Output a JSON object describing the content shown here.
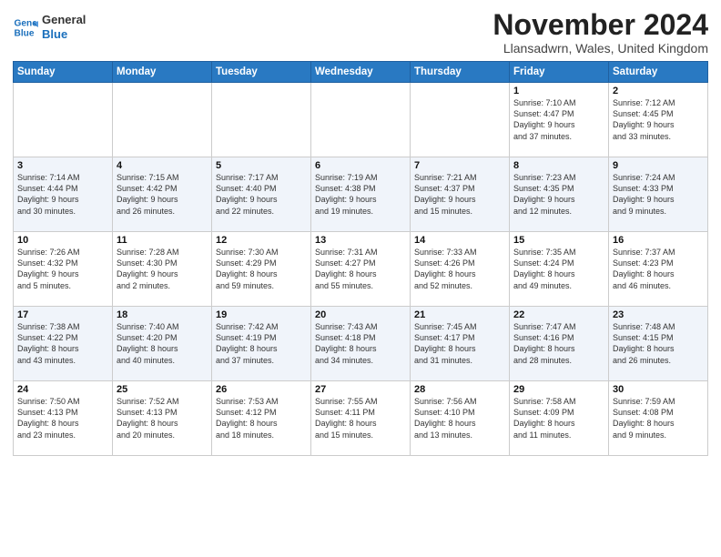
{
  "logo": {
    "line1": "General",
    "line2": "Blue",
    "icon_color": "#1a6fbc"
  },
  "title": "November 2024",
  "location": "Llansadwrn, Wales, United Kingdom",
  "days_of_week": [
    "Sunday",
    "Monday",
    "Tuesday",
    "Wednesday",
    "Thursday",
    "Friday",
    "Saturday"
  ],
  "weeks": [
    [
      {
        "day": "",
        "info": ""
      },
      {
        "day": "",
        "info": ""
      },
      {
        "day": "",
        "info": ""
      },
      {
        "day": "",
        "info": ""
      },
      {
        "day": "",
        "info": ""
      },
      {
        "day": "1",
        "info": "Sunrise: 7:10 AM\nSunset: 4:47 PM\nDaylight: 9 hours\nand 37 minutes."
      },
      {
        "day": "2",
        "info": "Sunrise: 7:12 AM\nSunset: 4:45 PM\nDaylight: 9 hours\nand 33 minutes."
      }
    ],
    [
      {
        "day": "3",
        "info": "Sunrise: 7:14 AM\nSunset: 4:44 PM\nDaylight: 9 hours\nand 30 minutes."
      },
      {
        "day": "4",
        "info": "Sunrise: 7:15 AM\nSunset: 4:42 PM\nDaylight: 9 hours\nand 26 minutes."
      },
      {
        "day": "5",
        "info": "Sunrise: 7:17 AM\nSunset: 4:40 PM\nDaylight: 9 hours\nand 22 minutes."
      },
      {
        "day": "6",
        "info": "Sunrise: 7:19 AM\nSunset: 4:38 PM\nDaylight: 9 hours\nand 19 minutes."
      },
      {
        "day": "7",
        "info": "Sunrise: 7:21 AM\nSunset: 4:37 PM\nDaylight: 9 hours\nand 15 minutes."
      },
      {
        "day": "8",
        "info": "Sunrise: 7:23 AM\nSunset: 4:35 PM\nDaylight: 9 hours\nand 12 minutes."
      },
      {
        "day": "9",
        "info": "Sunrise: 7:24 AM\nSunset: 4:33 PM\nDaylight: 9 hours\nand 9 minutes."
      }
    ],
    [
      {
        "day": "10",
        "info": "Sunrise: 7:26 AM\nSunset: 4:32 PM\nDaylight: 9 hours\nand 5 minutes."
      },
      {
        "day": "11",
        "info": "Sunrise: 7:28 AM\nSunset: 4:30 PM\nDaylight: 9 hours\nand 2 minutes."
      },
      {
        "day": "12",
        "info": "Sunrise: 7:30 AM\nSunset: 4:29 PM\nDaylight: 8 hours\nand 59 minutes."
      },
      {
        "day": "13",
        "info": "Sunrise: 7:31 AM\nSunset: 4:27 PM\nDaylight: 8 hours\nand 55 minutes."
      },
      {
        "day": "14",
        "info": "Sunrise: 7:33 AM\nSunset: 4:26 PM\nDaylight: 8 hours\nand 52 minutes."
      },
      {
        "day": "15",
        "info": "Sunrise: 7:35 AM\nSunset: 4:24 PM\nDaylight: 8 hours\nand 49 minutes."
      },
      {
        "day": "16",
        "info": "Sunrise: 7:37 AM\nSunset: 4:23 PM\nDaylight: 8 hours\nand 46 minutes."
      }
    ],
    [
      {
        "day": "17",
        "info": "Sunrise: 7:38 AM\nSunset: 4:22 PM\nDaylight: 8 hours\nand 43 minutes."
      },
      {
        "day": "18",
        "info": "Sunrise: 7:40 AM\nSunset: 4:20 PM\nDaylight: 8 hours\nand 40 minutes."
      },
      {
        "day": "19",
        "info": "Sunrise: 7:42 AM\nSunset: 4:19 PM\nDaylight: 8 hours\nand 37 minutes."
      },
      {
        "day": "20",
        "info": "Sunrise: 7:43 AM\nSunset: 4:18 PM\nDaylight: 8 hours\nand 34 minutes."
      },
      {
        "day": "21",
        "info": "Sunrise: 7:45 AM\nSunset: 4:17 PM\nDaylight: 8 hours\nand 31 minutes."
      },
      {
        "day": "22",
        "info": "Sunrise: 7:47 AM\nSunset: 4:16 PM\nDaylight: 8 hours\nand 28 minutes."
      },
      {
        "day": "23",
        "info": "Sunrise: 7:48 AM\nSunset: 4:15 PM\nDaylight: 8 hours\nand 26 minutes."
      }
    ],
    [
      {
        "day": "24",
        "info": "Sunrise: 7:50 AM\nSunset: 4:13 PM\nDaylight: 8 hours\nand 23 minutes."
      },
      {
        "day": "25",
        "info": "Sunrise: 7:52 AM\nSunset: 4:13 PM\nDaylight: 8 hours\nand 20 minutes."
      },
      {
        "day": "26",
        "info": "Sunrise: 7:53 AM\nSunset: 4:12 PM\nDaylight: 8 hours\nand 18 minutes."
      },
      {
        "day": "27",
        "info": "Sunrise: 7:55 AM\nSunset: 4:11 PM\nDaylight: 8 hours\nand 15 minutes."
      },
      {
        "day": "28",
        "info": "Sunrise: 7:56 AM\nSunset: 4:10 PM\nDaylight: 8 hours\nand 13 minutes."
      },
      {
        "day": "29",
        "info": "Sunrise: 7:58 AM\nSunset: 4:09 PM\nDaylight: 8 hours\nand 11 minutes."
      },
      {
        "day": "30",
        "info": "Sunrise: 7:59 AM\nSunset: 4:08 PM\nDaylight: 8 hours\nand 9 minutes."
      }
    ]
  ]
}
